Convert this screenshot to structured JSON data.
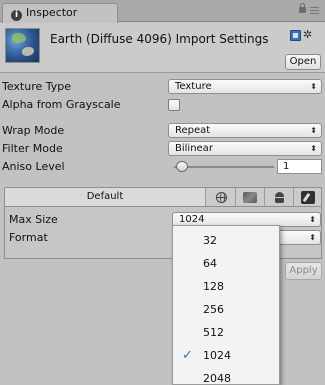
{
  "tab": {
    "title": "Inspector"
  },
  "header": {
    "title": "Earth (Diffuse 4096) Import Settings",
    "open_label": "Open"
  },
  "settings": {
    "texture_type": {
      "label": "Texture Type",
      "value": "Texture"
    },
    "alpha_from_grayscale": {
      "label": "Alpha from Grayscale",
      "checked": false
    },
    "wrap_mode": {
      "label": "Wrap Mode",
      "value": "Repeat"
    },
    "filter_mode": {
      "label": "Filter Mode",
      "value": "Bilinear"
    },
    "aniso_level": {
      "label": "Aniso Level",
      "value": "1"
    }
  },
  "platform": {
    "default_label": "Default",
    "icons": [
      "globe-icon",
      "flash-icon",
      "android-icon",
      "pencil-icon"
    ]
  },
  "platform_settings": {
    "max_size": {
      "label": "Max Size",
      "value": "1024"
    },
    "format": {
      "label": "Format",
      "value": ""
    }
  },
  "apply_label": "Apply",
  "max_size_menu": {
    "options": [
      "32",
      "64",
      "128",
      "256",
      "512",
      "1024",
      "2048"
    ],
    "selected": "1024",
    "check_glyph": "✓"
  },
  "glyphs": {
    "dropdown_arrows": "⬍",
    "info": "i",
    "gear": "✲"
  }
}
